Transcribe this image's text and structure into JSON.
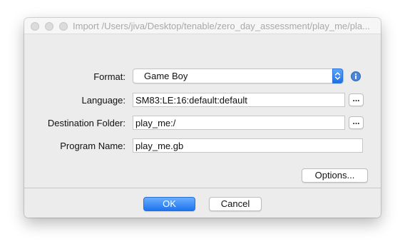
{
  "window": {
    "title": "Import /Users/jiva/Desktop/tenable/zero_day_assessment/play_me/pla..."
  },
  "form": {
    "format_label": "Format:",
    "format_value": "Game Boy",
    "language_label": "Language:",
    "language_value": "SM83:LE:16:default:default",
    "destination_label": "Destination Folder:",
    "destination_value": "play_me:/",
    "program_name_label": "Program Name:",
    "program_name_value": "play_me.gb",
    "browse_label": "...",
    "options_label": "Options..."
  },
  "buttons": {
    "ok_label": "OK",
    "cancel_label": "Cancel"
  },
  "icons": {
    "window_controls": [
      "close-icon",
      "minimize-icon",
      "zoom-icon"
    ],
    "dropdown": "chevron-up-down-icon",
    "info": "info-icon"
  },
  "colors": {
    "accent": "#1e74f0",
    "info_icon": "#4a87d6"
  }
}
